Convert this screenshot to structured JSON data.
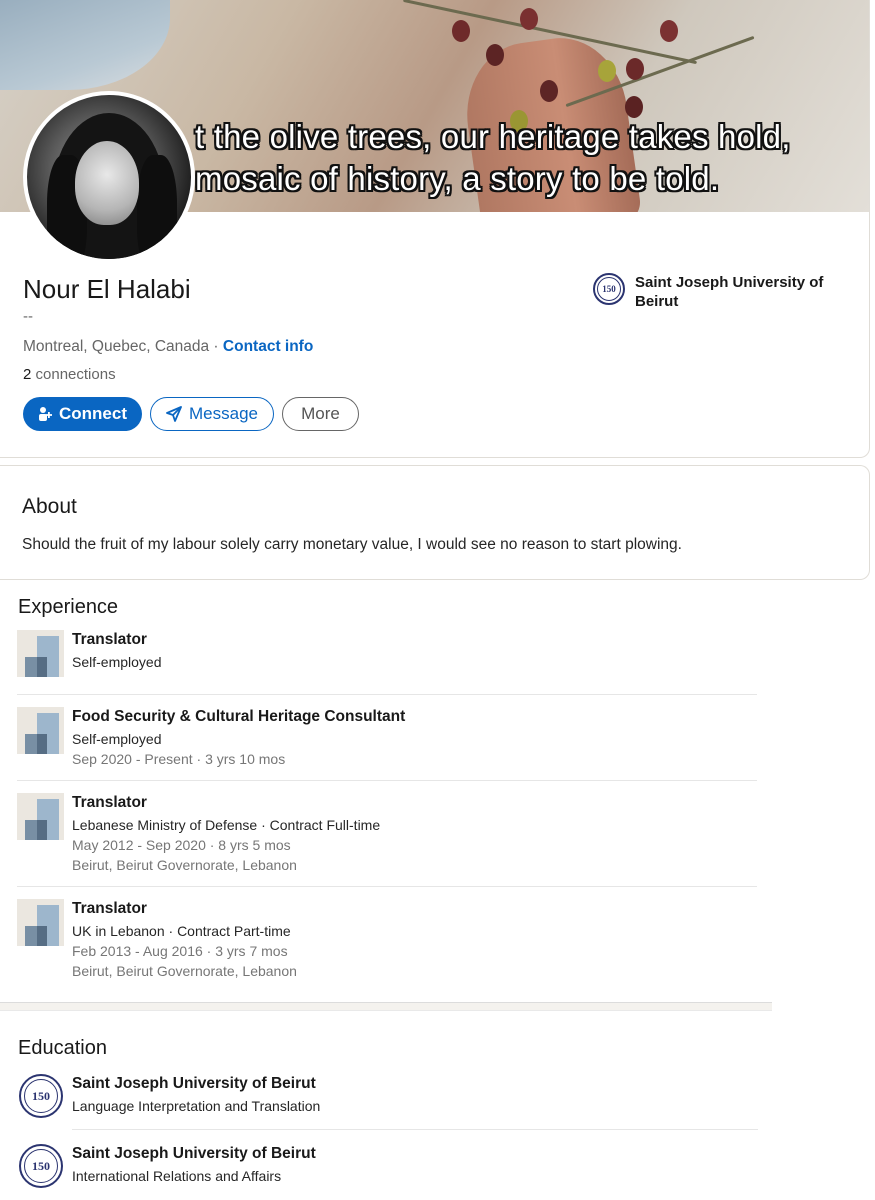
{
  "banner": {
    "caption_line1": "t the olive trees, our heritage takes hold,",
    "caption_line2": "mosaic of history, a story to be told."
  },
  "profile": {
    "name": "Nour El Halabi",
    "headline": "--",
    "location": "Montreal, Quebec, Canada",
    "separator": " · ",
    "contact_info": "Contact info",
    "connections_count": "2",
    "connections_label": " connections",
    "school": "Saint Joseph University of Beirut"
  },
  "actions": {
    "connect": "Connect",
    "message": "Message",
    "more": "More"
  },
  "about": {
    "title": "About",
    "text": "Should the fruit of my labour solely carry monetary value, I would see no reason to start plowing."
  },
  "experience": {
    "title": "Experience",
    "items": [
      {
        "role": "Translator",
        "org": "Self-employed"
      },
      {
        "role": "Food Security & Cultural Heritage Consultant",
        "org": "Self-employed",
        "dates": "Sep 2020 - Present · 3 yrs 10 mos"
      },
      {
        "role": "Translator",
        "org": "Lebanese Ministry of Defense · Contract Full-time",
        "dates": "May 2012 - Sep 2020 · 8 yrs 5 mos",
        "location": "Beirut, Beirut Governorate, Lebanon"
      },
      {
        "role": "Translator",
        "org": "UK in Lebanon · Contract Part-time",
        "dates": "Feb 2013 - Aug 2016 · 3 yrs 7 mos",
        "location": "Beirut, Beirut Governorate, Lebanon"
      }
    ]
  },
  "education": {
    "title": "Education",
    "items": [
      {
        "school": "Saint Joseph University of Beirut",
        "degree": "Language Interpretation and Translation"
      },
      {
        "school": "Saint Joseph University of Beirut",
        "degree": "International Relations and Affairs"
      }
    ]
  },
  "seal": {
    "text": "150",
    "top": "USJ"
  },
  "colors": {
    "accent": "#0a66c2",
    "seal": "#2b3470"
  }
}
